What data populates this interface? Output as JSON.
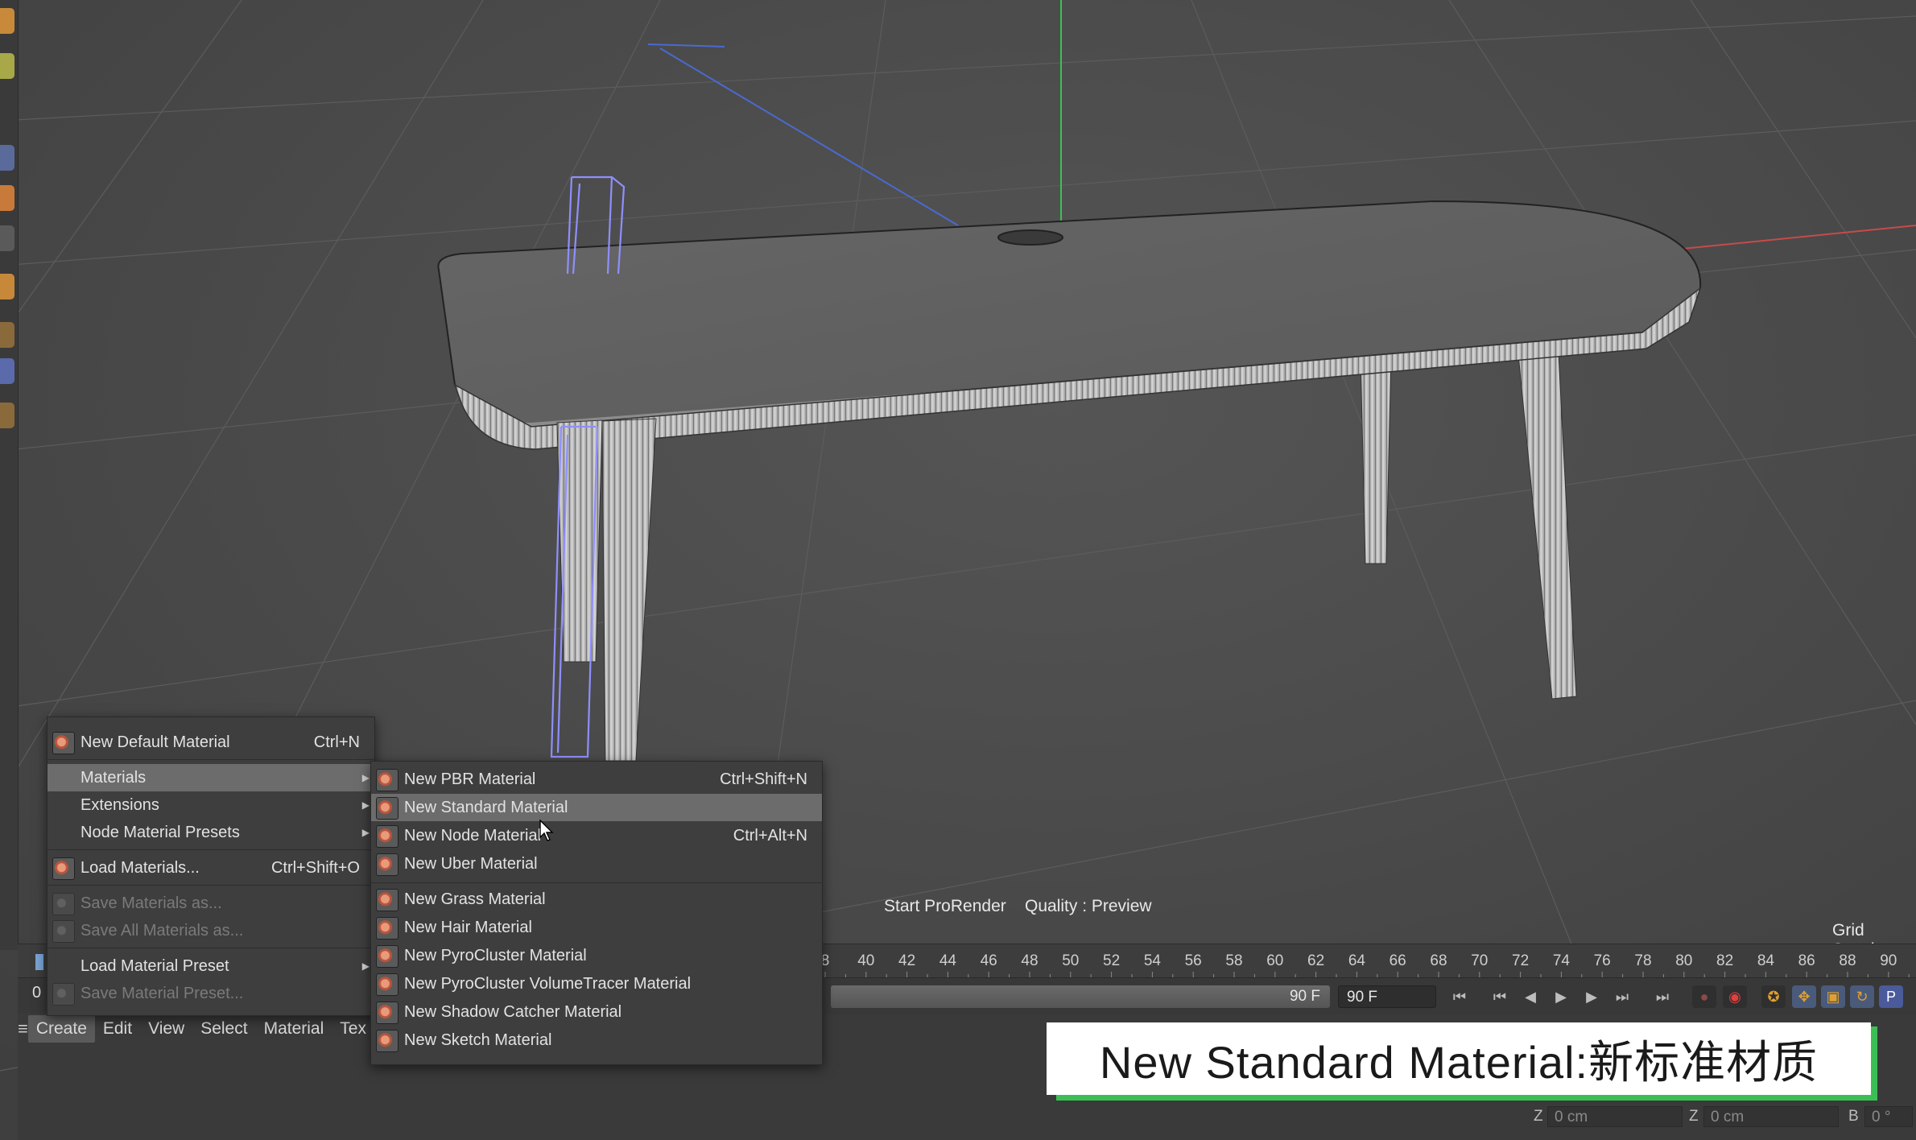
{
  "viewport": {
    "status_render": "Start ProRender",
    "status_quality": "Quality : Preview",
    "grid_spacing_label": "Grid Spacin"
  },
  "timeline": {
    "ruler_labels": [
      "8",
      "40",
      "42",
      "44",
      "46",
      "48",
      "50",
      "52",
      "54",
      "56",
      "58",
      "60",
      "62",
      "64",
      "66",
      "68",
      "70",
      "72",
      "74",
      "76",
      "78",
      "80",
      "82",
      "84",
      "86",
      "88",
      "90"
    ],
    "current_frame": "0",
    "slider_value": "90 F",
    "end_frame": "90 F"
  },
  "menubar": {
    "items": [
      "Create",
      "Edit",
      "View",
      "Select",
      "Material",
      "Tex"
    ]
  },
  "create_menu": {
    "items": [
      {
        "label": "New Default Material",
        "shortcut": "Ctrl+N"
      },
      {
        "label": "Materials",
        "shortcut": ""
      },
      {
        "label": "Extensions",
        "shortcut": ""
      },
      {
        "label": "Node Material Presets",
        "shortcut": ""
      },
      {
        "label": "Load Materials...",
        "shortcut": "Ctrl+Shift+O"
      },
      {
        "label": "Save Materials as...",
        "shortcut": ""
      },
      {
        "label": "Save All Materials as...",
        "shortcut": ""
      },
      {
        "label": "Load Material Preset",
        "shortcut": ""
      },
      {
        "label": "Save Material Preset...",
        "shortcut": ""
      }
    ]
  },
  "materials_submenu": {
    "items": [
      {
        "label": "New PBR Material",
        "shortcut": "Ctrl+Shift+N"
      },
      {
        "label": "New Standard Material",
        "shortcut": ""
      },
      {
        "label": "New Node Material",
        "shortcut": "Ctrl+Alt+N"
      },
      {
        "label": "New Uber Material",
        "shortcut": ""
      },
      {
        "label": "New Grass Material",
        "shortcut": ""
      },
      {
        "label": "New Hair Material",
        "shortcut": ""
      },
      {
        "label": "New PyroCluster Material",
        "shortcut": ""
      },
      {
        "label": "New PyroCluster VolumeTracer Material",
        "shortcut": ""
      },
      {
        "label": "New Shadow Catcher Material",
        "shortcut": ""
      },
      {
        "label": "New Sketch Material",
        "shortcut": ""
      }
    ]
  },
  "caption": {
    "text": "New Standard Material:新标准材质"
  },
  "coordinates": {
    "z1_label": "Z",
    "z1_value": "0 cm",
    "z2_label": "Z",
    "z2_value": "0 cm",
    "b_label": "B",
    "b_value": "0 °"
  },
  "colors": {
    "viewport_bg": "#4a4a4a",
    "menu_bg": "#3e3e3e",
    "menu_highlight": "#6c6c6c",
    "caption_accent": "#3bbf55",
    "axis_y": "#3fbf5a",
    "axis_x": "#c84a4a",
    "axis_z": "#4a6ad0",
    "selection_wire": "#8f8fff"
  }
}
